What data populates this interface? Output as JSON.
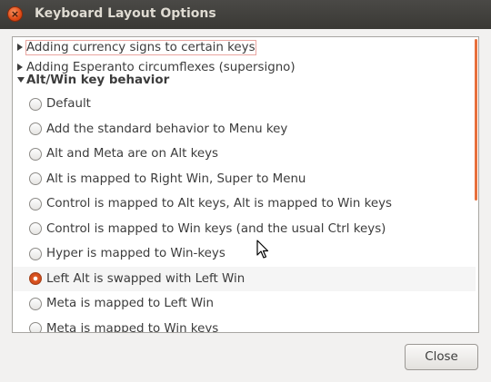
{
  "window": {
    "title": "Keyboard Layout Options",
    "close_glyph": "×"
  },
  "tree": {
    "groups": [
      {
        "label": "Adding currency signs to certain keys",
        "expanded": false,
        "focused": true
      },
      {
        "label": "Adding Esperanto circumflexes (supersigno)",
        "expanded": false,
        "focused": false
      },
      {
        "label": "Alt/Win key behavior",
        "expanded": true,
        "focused": false
      }
    ],
    "options": [
      {
        "label": "Default",
        "checked": false
      },
      {
        "label": "Add the standard behavior to Menu key",
        "checked": false
      },
      {
        "label": "Alt and Meta are on Alt keys",
        "checked": false
      },
      {
        "label": "Alt is mapped to Right Win, Super to Menu",
        "checked": false
      },
      {
        "label": "Control is mapped to Alt keys, Alt is mapped to Win keys",
        "checked": false
      },
      {
        "label": "Control is mapped to Win keys (and the usual Ctrl keys)",
        "checked": false
      },
      {
        "label": "Hyper is mapped to Win-keys",
        "checked": false
      },
      {
        "label": "Left Alt is swapped with Left Win",
        "checked": true
      },
      {
        "label": "Meta is mapped to Left Win",
        "checked": false
      },
      {
        "label": "Meta is mapped to Win keys",
        "checked": false
      }
    ]
  },
  "footer": {
    "close_label": "Close"
  },
  "colors": {
    "accent": "#e05a24",
    "titlebar": "#3c3b37",
    "background": "#f2f1f0"
  }
}
